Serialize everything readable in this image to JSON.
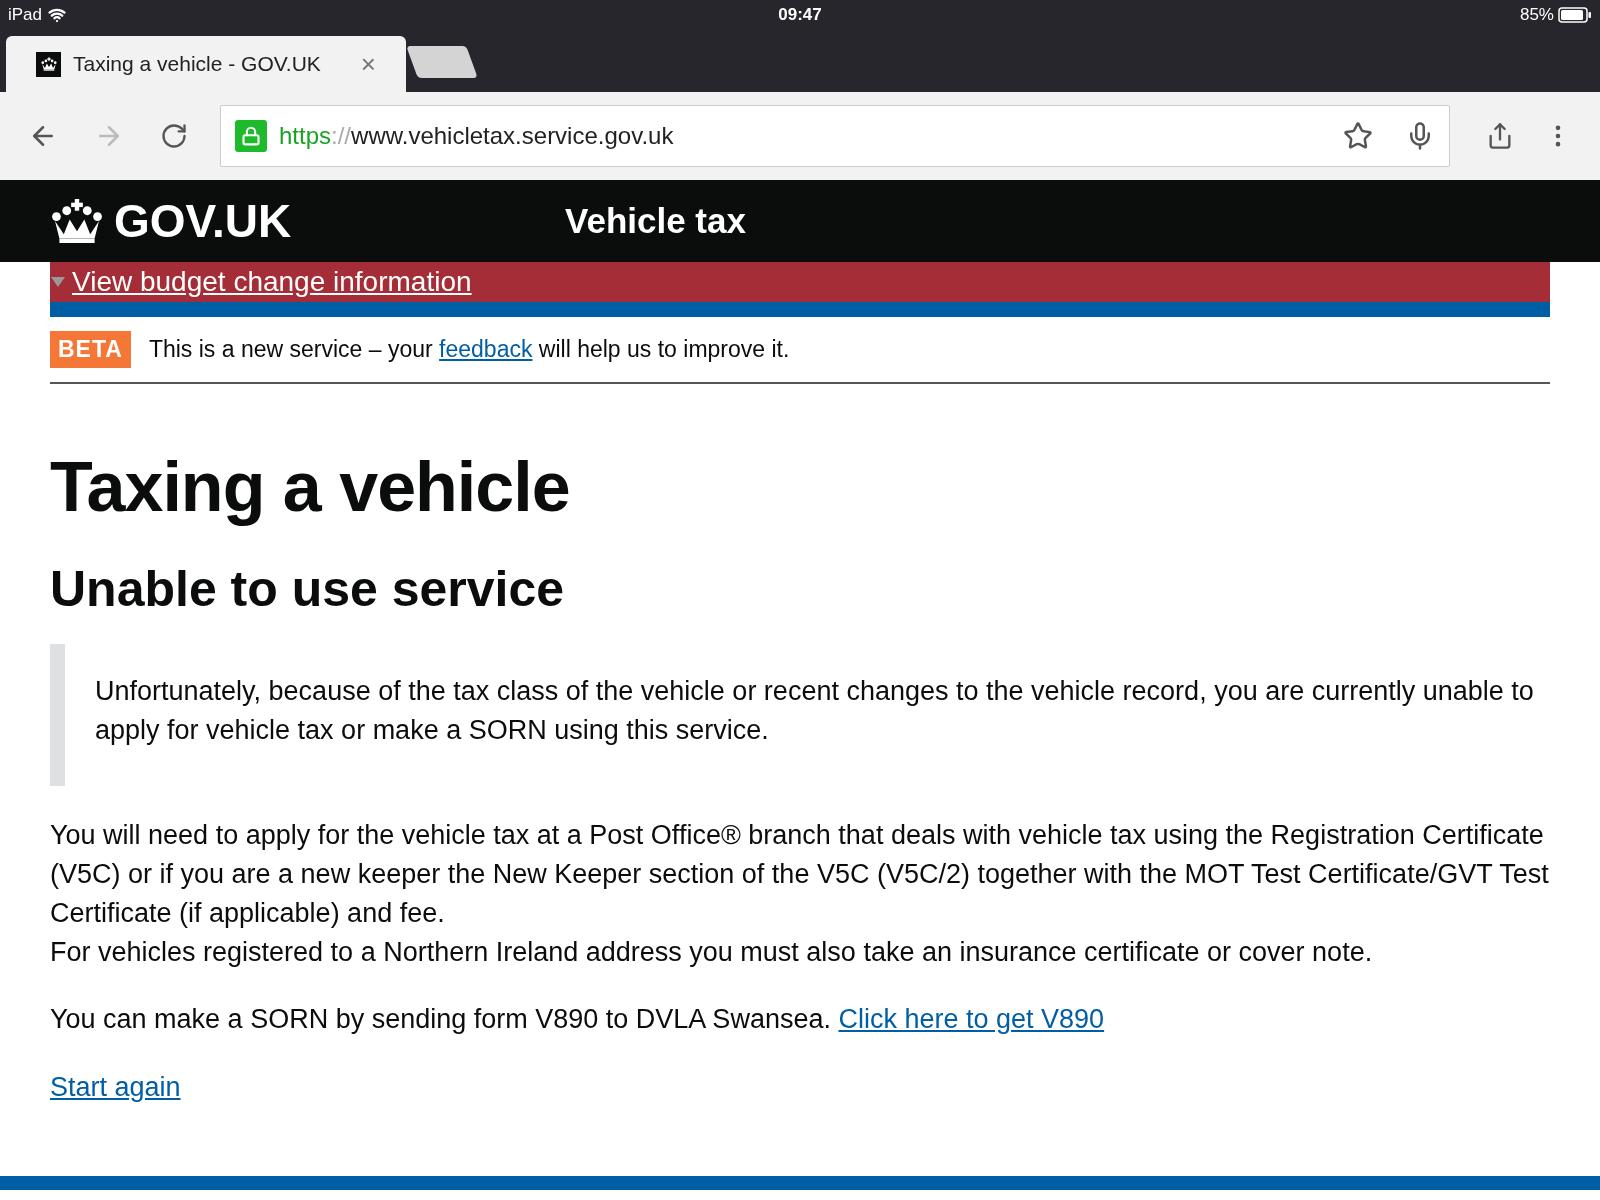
{
  "status_bar": {
    "device": "iPad",
    "time": "09:47",
    "battery": "85%"
  },
  "tabs": [
    {
      "title": "Taxing a vehicle - GOV.UK",
      "selected": true,
      "close": "×"
    },
    {
      "selected": false
    }
  ],
  "address_bar": {
    "scheme": "https",
    "separator": "://",
    "host": "www.vehicletax.service.gov.uk",
    "secure": true
  },
  "header": {
    "logo": "GOV.UK",
    "service": "Vehicle tax"
  },
  "banner": {
    "link": "View budget change information"
  },
  "phase": {
    "tag": "BETA",
    "before": "This is a new service – your",
    "link": "feedback",
    "after": "will help us to improve it."
  },
  "title": "Taxing a vehicle",
  "subtitle": "Unable to use service",
  "inset": "Unfortunately, because of the tax class of the vehicle or recent changes to the vehicle record, you are currently unable to apply for vehicle tax or make a SORN using this service.",
  "paragraphs": [
    "You will need to apply for the vehicle tax at a Post Office® branch that deals with vehicle tax using the Registration Certificate (V5C) or if you are a new keeper the New Keeper section of the V5C (V5C/2) together with the MOT Test Certificate/GVT Test Certificate (if applicable) and fee.",
    "For vehicles registered to a Northern Ireland address you must also take an insurance certificate or cover note."
  ],
  "sorn": {
    "text": "You can make a SORN by sending form V890 to DVLA Swansea.",
    "link": "Click here to get V890"
  },
  "start_again": "Start again"
}
